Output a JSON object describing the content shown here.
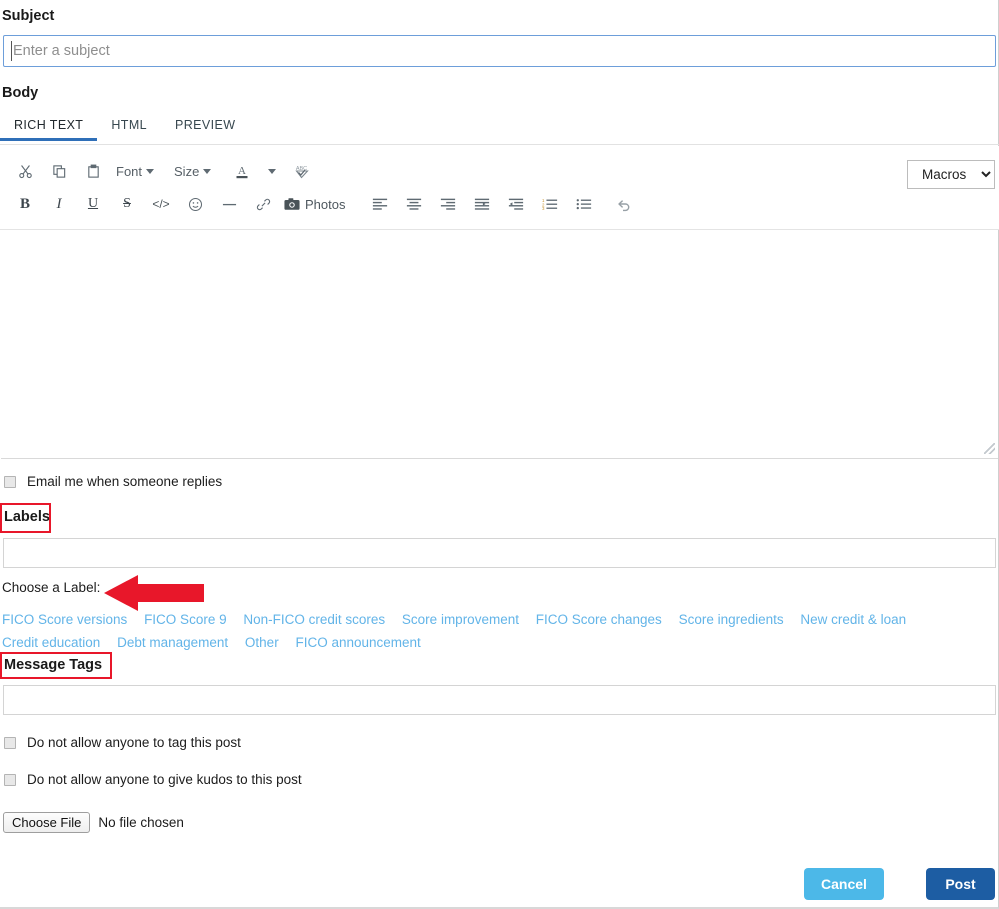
{
  "form": {
    "subject": {
      "label": "Subject",
      "placeholder": "Enter a subject",
      "value": ""
    },
    "body": {
      "label": "Body",
      "tabs": [
        {
          "label": "RICH TEXT",
          "active": true
        },
        {
          "label": "HTML",
          "active": false
        },
        {
          "label": "PREVIEW",
          "active": false
        }
      ],
      "content": ""
    }
  },
  "toolbar": {
    "macros_label": "Macros",
    "row1": [
      {
        "name": "cut-icon",
        "label": ""
      },
      {
        "name": "copy-icon",
        "label": ""
      },
      {
        "name": "paste-icon",
        "label": ""
      },
      {
        "name": "font-dropdown",
        "label": "Font"
      },
      {
        "name": "size-dropdown",
        "label": "Size"
      },
      {
        "name": "text-color-icon",
        "label": "A"
      },
      {
        "name": "color-dropdown-caret",
        "label": ""
      },
      {
        "name": "spellcheck-icon",
        "label": ""
      }
    ],
    "row2": [
      {
        "name": "bold-icon",
        "label": "B"
      },
      {
        "name": "italic-icon",
        "label": "I"
      },
      {
        "name": "underline-icon",
        "label": "U"
      },
      {
        "name": "strikethrough-icon",
        "label": "S"
      },
      {
        "name": "code-icon",
        "label": "</>"
      },
      {
        "name": "emoji-icon",
        "label": ""
      },
      {
        "name": "horizontal-rule-icon",
        "label": ""
      },
      {
        "name": "link-icon",
        "label": ""
      },
      {
        "name": "photos-button",
        "label": "Photos"
      },
      {
        "name": "align-left-icon",
        "label": ""
      },
      {
        "name": "align-center-icon",
        "label": ""
      },
      {
        "name": "align-right-icon",
        "label": ""
      },
      {
        "name": "align-justify-icon",
        "label": ""
      },
      {
        "name": "outdent-icon",
        "label": ""
      },
      {
        "name": "ordered-list-icon",
        "label": ""
      },
      {
        "name": "unordered-list-icon",
        "label": ""
      },
      {
        "name": "undo-icon",
        "label": ""
      }
    ]
  },
  "options": {
    "email_reply": "Email me when someone replies",
    "no_tag": "Do not allow anyone to tag this post",
    "no_kudos": "Do not allow anyone to give kudos to this post"
  },
  "labels": {
    "heading": "Labels",
    "input_value": "",
    "choose_text": "Choose a Label:",
    "items": [
      "FICO Score versions",
      "FICO Score 9",
      "Non-FICO credit scores",
      "Score improvement",
      "FICO Score changes",
      "Score ingredients",
      "New credit & loan",
      "Credit education",
      "Debt management",
      "Other",
      "FICO announcement"
    ]
  },
  "message_tags": {
    "heading": "Message Tags",
    "input_value": ""
  },
  "attachment": {
    "button_label": "Choose File",
    "status": "No file chosen"
  },
  "footer": {
    "cancel_label": "Cancel",
    "post_label": "Post"
  },
  "colors": {
    "link": "#62b4e8",
    "tab_active_underline": "#2f6fb8",
    "cancel_button": "#4cb8e8",
    "post_button": "#1d5da3",
    "annotation_red": "#e8172a",
    "subject_border": "#6d9eda"
  }
}
